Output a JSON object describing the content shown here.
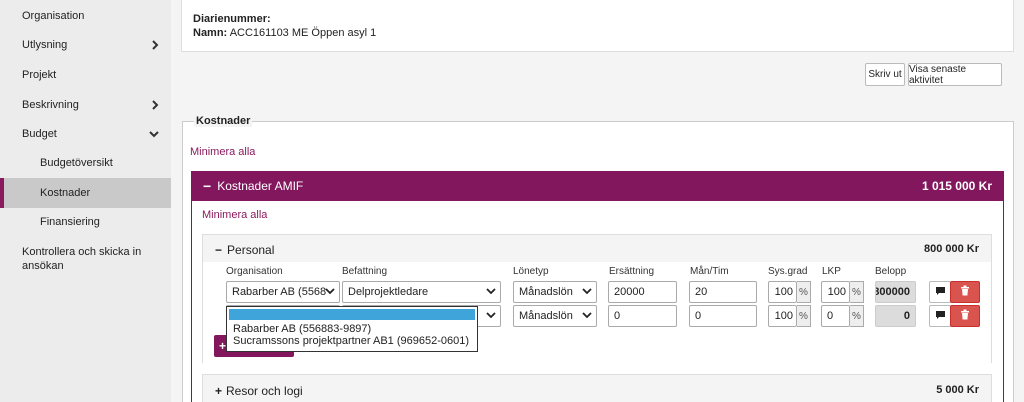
{
  "sidebar": {
    "items": [
      {
        "label": "Organisation"
      },
      {
        "label": "Utlysning"
      },
      {
        "label": "Projekt"
      },
      {
        "label": "Beskrivning"
      },
      {
        "label": "Budget"
      },
      {
        "label": "Budgetöversikt"
      },
      {
        "label": "Kostnader"
      },
      {
        "label": "Finansiering"
      },
      {
        "label": "Kontrollera och skicka in ansökan"
      }
    ]
  },
  "header": {
    "diarie_label": "Diarienummer:",
    "name_label": "Namn:",
    "name_value": "ACC161103 ME Öppen asyl 1"
  },
  "actions": {
    "print": "Skriv ut",
    "latest_activity": "Visa senaste aktivitet"
  },
  "costs": {
    "section_title": "Kostnader",
    "minimize_all": "Minimera alla",
    "amif": {
      "title": "Kostnader AMIF",
      "total": "1 015 000 Kr",
      "minimize_all": "Minimera alla",
      "personal": {
        "title": "Personal",
        "total": "800 000 Kr",
        "columns": [
          "Organisation",
          "Befattning",
          "Lönetyp",
          "Ersättning",
          "Mån/Tim",
          "Sys.grad",
          "LKP",
          "Belopp"
        ],
        "rows": [
          {
            "organisation": "Rabarber AB (5568",
            "befattning": "Delprojektledare",
            "lonetyp": "Månadslön",
            "ersattning": "20000",
            "man_tim": "20",
            "sysgrad": "100",
            "lkp": "100",
            "belopp": "800000"
          },
          {
            "organisation": "",
            "befattning": "",
            "lonetyp": "Månadslön",
            "ersattning": "0",
            "man_tim": "0",
            "sysgrad": "100",
            "lkp": "0",
            "belopp": "0"
          }
        ],
        "percent_unit": "%",
        "dropdown_options": [
          "",
          "Rabarber AB (556883-9897)",
          "Sucramssons projektpartner AB1 (969652-0601)"
        ]
      },
      "resor": {
        "title": "Resor och logi",
        "total": "5 000 Kr"
      }
    }
  },
  "colors": {
    "accent": "#82175d",
    "delete": "#d9534f",
    "selected_option": "#3ea4d9"
  }
}
